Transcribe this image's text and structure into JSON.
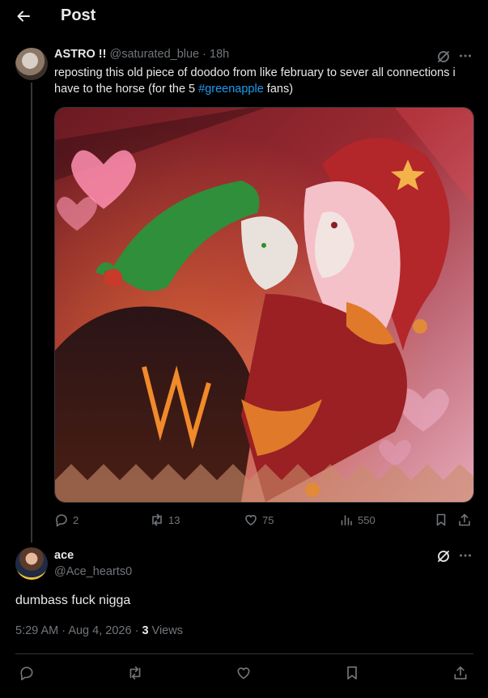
{
  "header": {
    "title": "Post"
  },
  "parent_post": {
    "display_name": "ASTRO !!",
    "handle": "@saturated_blue",
    "separator": "·",
    "time": "18h",
    "text_before": "reposting this old piece of doodoo from like february to sever all connections i have to the horse (for the 5 ",
    "hashtag": "#greenapple",
    "text_after": " fans)",
    "stats": {
      "replies": "2",
      "reposts": "13",
      "likes": "75",
      "views": "550"
    }
  },
  "reply_post": {
    "display_name": "ace",
    "handle": "@Ace_hearts0",
    "text": "dumbass fuck nigga",
    "time": "5:29 AM",
    "separator": "·",
    "date": "Aug 4, 2026",
    "views_count": "3",
    "views_label": "Views"
  },
  "colors": {
    "accent": "#1d9bf0",
    "muted": "#71767b",
    "text": "#e7e9ea",
    "background": "#000000"
  },
  "icons": [
    "back-arrow-icon",
    "grok-icon",
    "more-icon",
    "reply-icon",
    "repost-icon",
    "like-icon",
    "views-icon",
    "bookmark-icon",
    "share-icon"
  ]
}
